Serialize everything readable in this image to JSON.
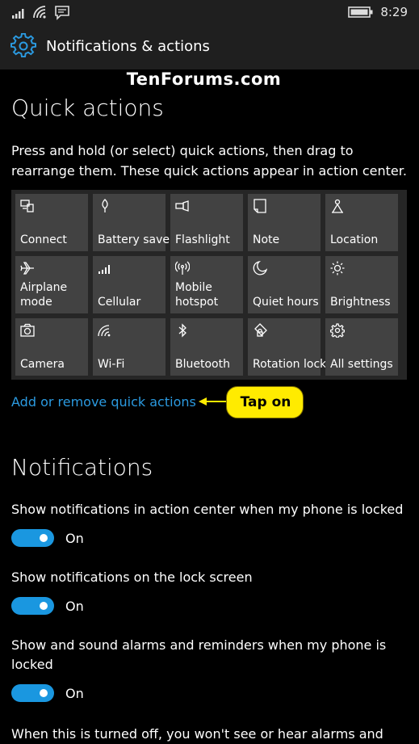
{
  "status_bar": {
    "time": "8:29",
    "icons": [
      "signal-icon",
      "wifi-icon",
      "message-icon",
      "battery-icon"
    ]
  },
  "header": {
    "title": "Notifications & actions",
    "icon": "gear-icon"
  },
  "watermark": "TenForums.com",
  "quick_actions": {
    "heading": "Quick actions",
    "description": "Press and hold (or select) quick actions, then drag to rearrange them. These quick actions appear in action center.",
    "tiles": [
      {
        "label": "Connect",
        "icon": "connect-icon"
      },
      {
        "label": "Battery saver",
        "icon": "battery-saver-icon"
      },
      {
        "label": "Flashlight",
        "icon": "flashlight-icon"
      },
      {
        "label": "Note",
        "icon": "note-icon"
      },
      {
        "label": "Location",
        "icon": "location-icon"
      },
      {
        "label": "Airplane mode",
        "icon": "airplane-icon"
      },
      {
        "label": "Cellular",
        "icon": "cellular-icon"
      },
      {
        "label": "Mobile hotspot",
        "icon": "hotspot-icon"
      },
      {
        "label": "Quiet hours",
        "icon": "moon-icon"
      },
      {
        "label": "Brightness",
        "icon": "sun-icon"
      },
      {
        "label": "Camera",
        "icon": "camera-icon"
      },
      {
        "label": "Wi-Fi",
        "icon": "wifi-icon"
      },
      {
        "label": "Bluetooth",
        "icon": "bluetooth-icon"
      },
      {
        "label": "Rotation lock",
        "icon": "rotation-lock-icon"
      },
      {
        "label": "All settings",
        "icon": "gear-icon"
      }
    ],
    "link": "Add or remove quick actions",
    "callout": "Tap on"
  },
  "notifications": {
    "heading": "Notifications",
    "settings": [
      {
        "label": "Show notifications in action center when my phone is locked",
        "state": "On"
      },
      {
        "label": "Show notifications on the lock screen",
        "state": "On"
      },
      {
        "label": "Show and sound alarms and reminders when my phone is locked",
        "state": "On"
      }
    ],
    "footer_text": "When this is turned off, you won't see or hear alarms and"
  },
  "colors": {
    "accent": "#1a97e0",
    "link": "#2b9ae0",
    "tile": "#424242",
    "callout": "#ffeb00"
  }
}
